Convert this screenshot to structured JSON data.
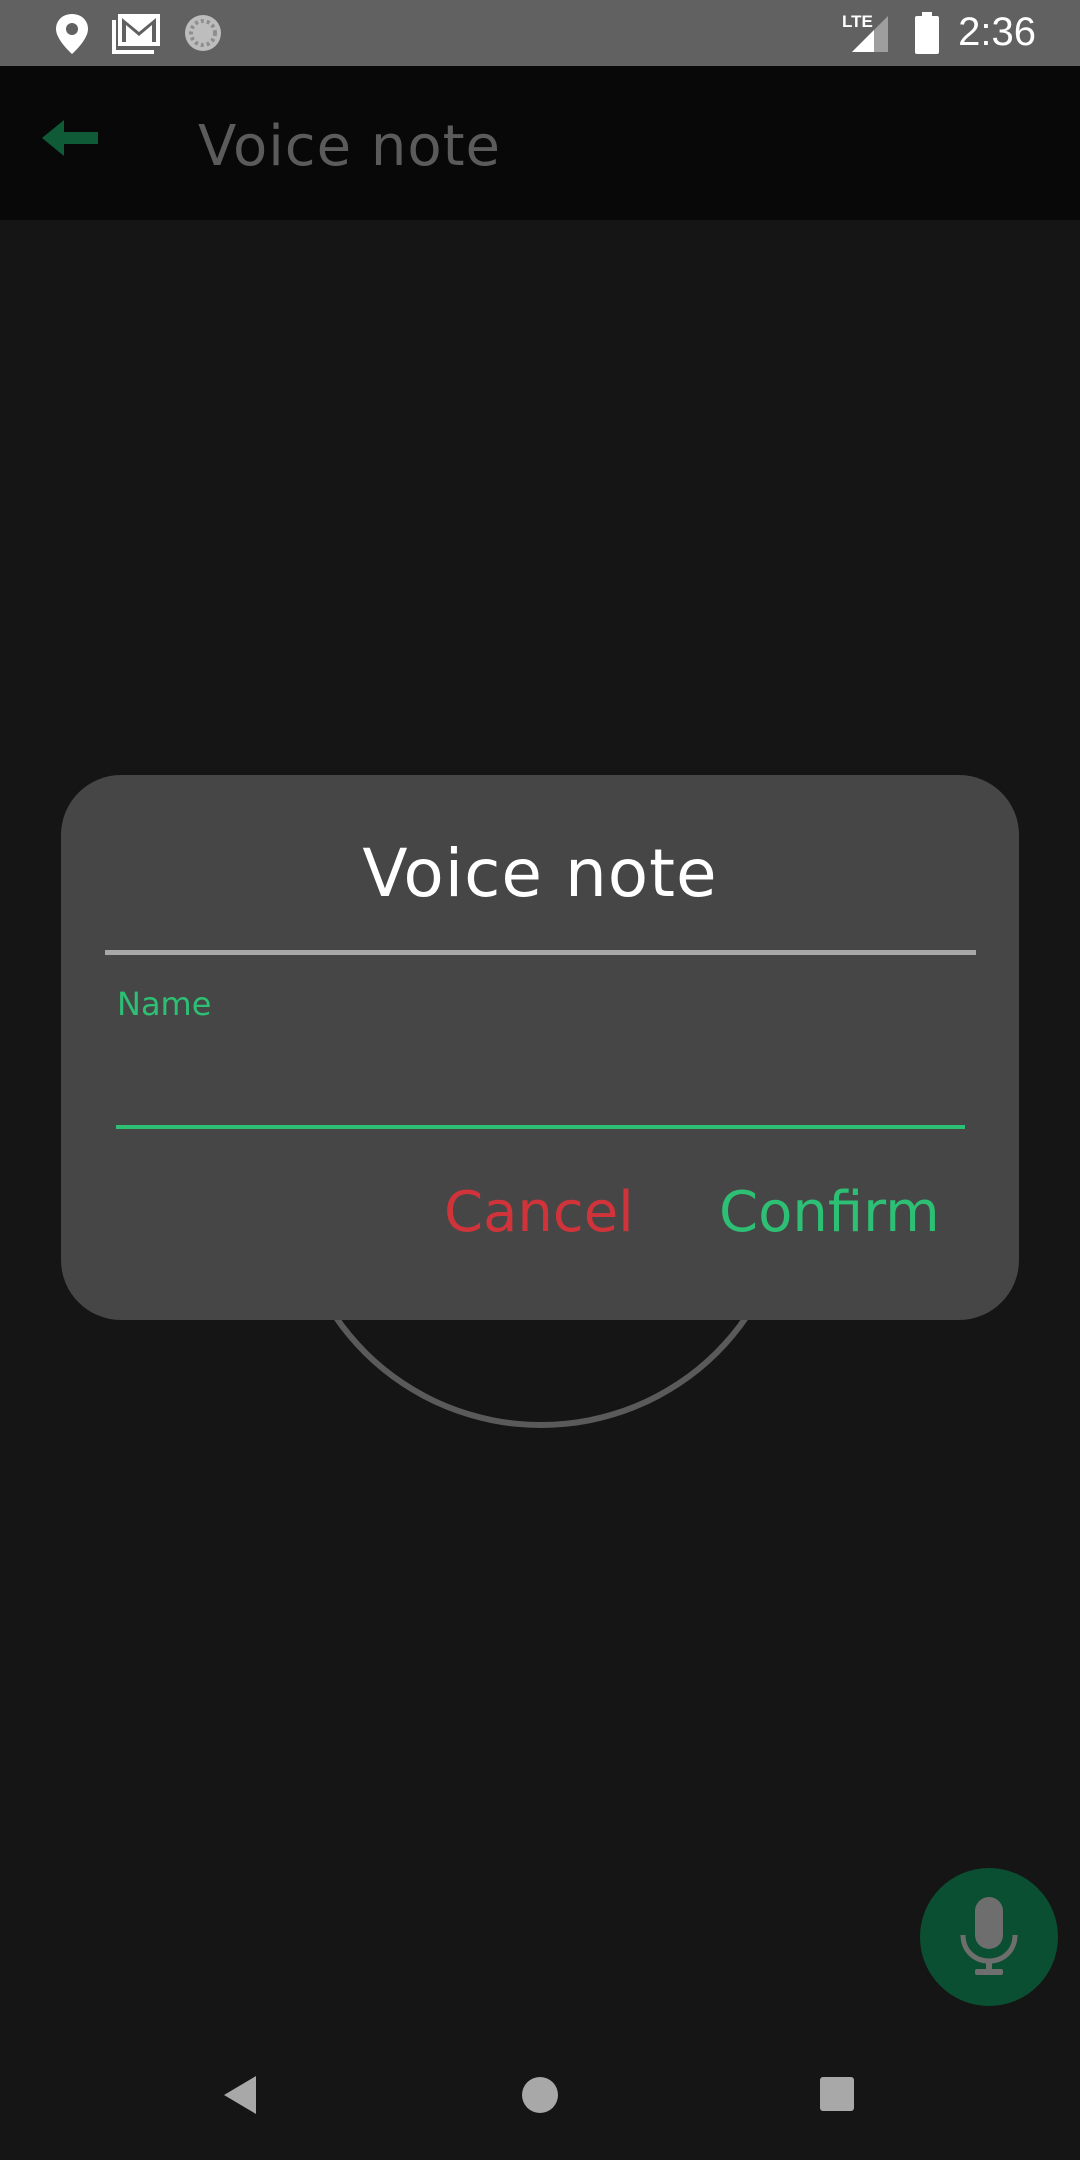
{
  "status_bar": {
    "time": "2:36",
    "network_label": "LTE",
    "icons": [
      "location-icon",
      "gmail-icon",
      "sync-icon",
      "signal-icon",
      "battery-icon"
    ]
  },
  "app_bar": {
    "title": "Voice note",
    "back_icon": "arrow-left-icon"
  },
  "dialog": {
    "title": "Voice note",
    "field_label": "Name",
    "input_value": "",
    "cancel_label": "Cancel",
    "confirm_label": "Confirm"
  },
  "fab": {
    "icon": "microphone-icon"
  },
  "nav_bar": {
    "icons": [
      "back-triangle-icon",
      "home-circle-icon",
      "recents-square-icon"
    ]
  },
  "colors": {
    "accent_green": "#2dbf74",
    "cancel_red": "#d0343a",
    "dialog_bg": "#464646",
    "screen_bg": "#151515",
    "fab_bg": "#0b4f33"
  }
}
